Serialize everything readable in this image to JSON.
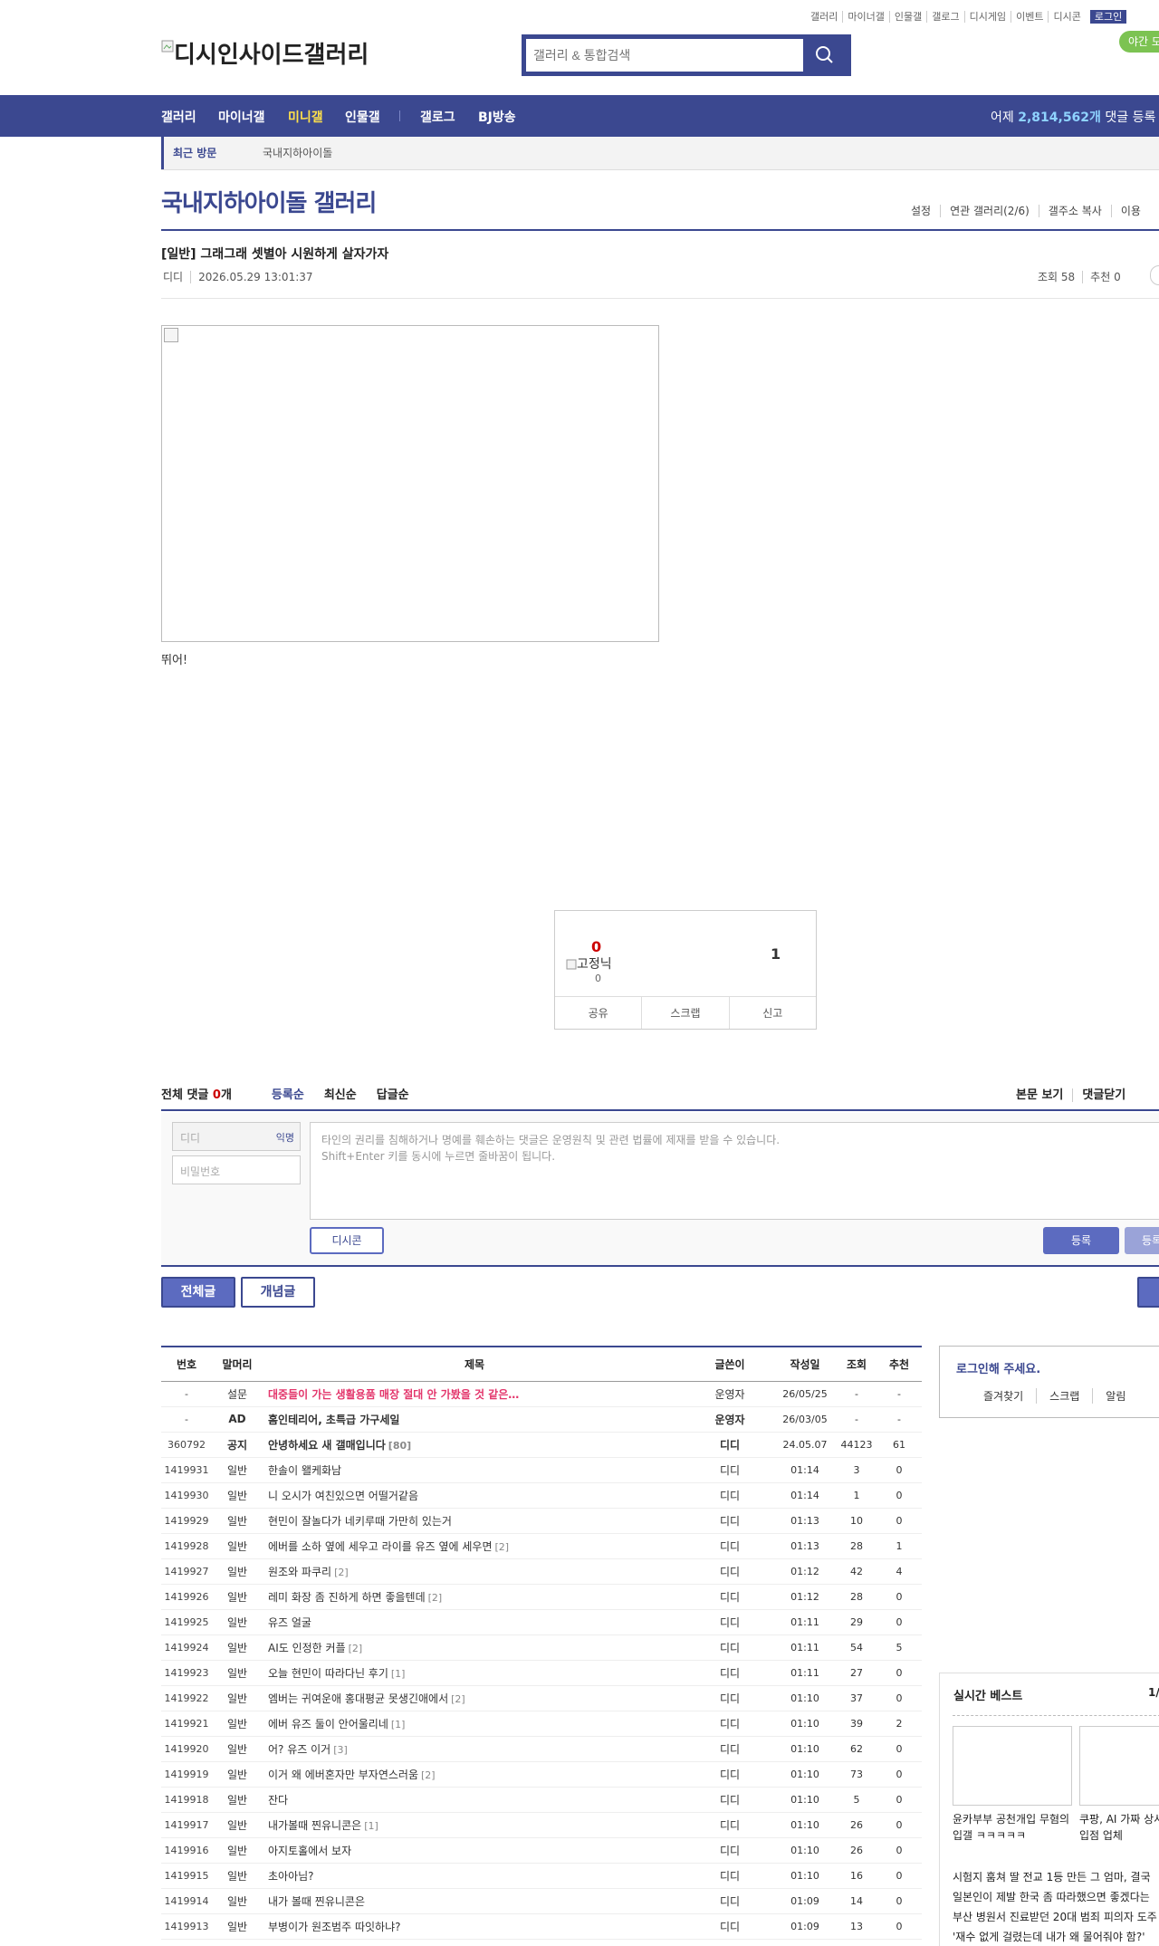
{
  "top_nav": [
    "갤러리",
    "마이너갤",
    "인물갤",
    "갤로그",
    "디시게임",
    "이벤트",
    "디시콘"
  ],
  "login_label": "로그인",
  "logo_text": "디시인사이드갤러리",
  "search": {
    "placeholder": "갤러리 & 통합검색"
  },
  "night_mode": "야간 모드",
  "gnb": {
    "items": [
      "갤러리",
      "마이너갤",
      "미니갤",
      "인물갤",
      "갤로그",
      "BJ방송"
    ],
    "active": "미니갤",
    "stat_prefix": "어제 ",
    "stat_value": "2,814,562개",
    "stat_suffix": " 댓글 등록"
  },
  "subbar": {
    "recent_label": "최근 방문",
    "recent_item": "국내지하아이돌"
  },
  "gallery": {
    "title": "국내지하아이돌 갤러리",
    "utils": [
      "설정",
      "연관 갤러리(2/6)",
      "갤주소 복사",
      "이용"
    ]
  },
  "post": {
    "title": "[일반] 그래그래 셋별아 시원하게 살자가자",
    "writer": "디디",
    "datetime": "2026.05.29 13:01:37",
    "views": "조회 58",
    "recommends": "추천 0",
    "body": "뛰어!"
  },
  "recommend_box": {
    "up_count": "0",
    "fixed_label": "고정닉",
    "fixed_count": "0",
    "down_count": "1",
    "actions": [
      "공유",
      "스크랩",
      "신고"
    ]
  },
  "comments": {
    "total_label": "전체 댓글",
    "total_count": "0",
    "total_unit": "개",
    "sorts": [
      "등록순",
      "최신순",
      "답글순"
    ],
    "right_links": [
      "본문 보기",
      "댓글닫기"
    ],
    "name_placeholder": "디디",
    "anon_label": "익명",
    "password_placeholder": "비밀번호",
    "text_line1": "타인의 권리를 침해하거나 명예를 훼손하는 댓글은 운영원칙 및 관련 법률에 제재를 받을 수 있습니다.",
    "text_line2": "Shift+Enter 키를 동시에 누르면 줄바꿈이 됩니다.",
    "dccon_label": "디시콘",
    "submit_label": "등록",
    "submit2_label": "등록"
  },
  "list_tabs": {
    "all": "전체글",
    "concept": "개념글"
  },
  "table": {
    "headers": [
      "번호",
      "말머리",
      "제목",
      "글쓴이",
      "작성일",
      "조회",
      "추천"
    ],
    "rows": [
      {
        "num": "-",
        "head": "설문",
        "title": "대중들이 가는 생활용품 매장 절대 안 가봤을 것 같은…",
        "rc": "",
        "writer": "운영자",
        "date": "26/05/25",
        "views": "-",
        "rec": "-",
        "type": "survey"
      },
      {
        "num": "-",
        "head": "AD",
        "title": "홈인테리어, 초특급 가구세일",
        "rc": "",
        "writer": "운영자",
        "date": "26/03/05",
        "views": "-",
        "rec": "-",
        "type": "notice"
      },
      {
        "num": "360792",
        "head": "공지",
        "title": "안녕하세요 새 갤매입니다",
        "rc": "[80]",
        "writer": "디디",
        "date": "24.05.07",
        "views": "44123",
        "rec": "61",
        "type": "notice"
      },
      {
        "num": "1419931",
        "head": "일반",
        "title": "한솔이 왤케화남",
        "rc": "",
        "writer": "디디",
        "date": "01:14",
        "views": "3",
        "rec": "0",
        "type": ""
      },
      {
        "num": "1419930",
        "head": "일반",
        "title": "니 오시가 여친있으면 어떨거같음",
        "rc": "",
        "writer": "디디",
        "date": "01:14",
        "views": "1",
        "rec": "0",
        "type": ""
      },
      {
        "num": "1419929",
        "head": "일반",
        "title": "현민이 잘놀다가 네키루때 가만히 있는거",
        "rc": "",
        "writer": "디디",
        "date": "01:13",
        "views": "10",
        "rec": "0",
        "type": ""
      },
      {
        "num": "1419928",
        "head": "일반",
        "title": "에버를 소하 옆에 세우고 라이를 유즈 옆에 세우면",
        "rc": "[2]",
        "writer": "디디",
        "date": "01:13",
        "views": "28",
        "rec": "1",
        "type": ""
      },
      {
        "num": "1419927",
        "head": "일반",
        "title": "원조와 파쿠리",
        "rc": "[2]",
        "writer": "디디",
        "date": "01:12",
        "views": "42",
        "rec": "4",
        "type": ""
      },
      {
        "num": "1419926",
        "head": "일반",
        "title": "레미 화장 좀 진하게 하면 좋을텐데",
        "rc": "[2]",
        "writer": "디디",
        "date": "01:12",
        "views": "28",
        "rec": "0",
        "type": ""
      },
      {
        "num": "1419925",
        "head": "일반",
        "title": "유즈 얼굴",
        "rc": "",
        "writer": "디디",
        "date": "01:11",
        "views": "29",
        "rec": "0",
        "type": ""
      },
      {
        "num": "1419924",
        "head": "일반",
        "title": "AI도 인정한 커플",
        "rc": "[2]",
        "writer": "디디",
        "date": "01:11",
        "views": "54",
        "rec": "5",
        "type": ""
      },
      {
        "num": "1419923",
        "head": "일반",
        "title": "오늘 현민이 따라다닌 후기",
        "rc": "[1]",
        "writer": "디디",
        "date": "01:11",
        "views": "27",
        "rec": "0",
        "type": ""
      },
      {
        "num": "1419922",
        "head": "일반",
        "title": "엠버는 귀여운애 홍대평균 못생긴애에서",
        "rc": "[2]",
        "writer": "디디",
        "date": "01:10",
        "views": "37",
        "rec": "0",
        "type": ""
      },
      {
        "num": "1419921",
        "head": "일반",
        "title": "에버 유즈 둘이 안어울리네",
        "rc": "[1]",
        "writer": "디디",
        "date": "01:10",
        "views": "39",
        "rec": "2",
        "type": ""
      },
      {
        "num": "1419920",
        "head": "일반",
        "title": "어? 유즈 이거",
        "rc": "[3]",
        "writer": "디디",
        "date": "01:10",
        "views": "62",
        "rec": "0",
        "type": ""
      },
      {
        "num": "1419919",
        "head": "일반",
        "title": "이거 왜 에버혼자만 부자연스러움",
        "rc": "[2]",
        "writer": "디디",
        "date": "01:10",
        "views": "73",
        "rec": "0",
        "type": ""
      },
      {
        "num": "1419918",
        "head": "일반",
        "title": "잔다",
        "rc": "",
        "writer": "디디",
        "date": "01:10",
        "views": "5",
        "rec": "0",
        "type": ""
      },
      {
        "num": "1419917",
        "head": "일반",
        "title": "내가볼때 찐유니콘은",
        "rc": "[1]",
        "writer": "디디",
        "date": "01:10",
        "views": "26",
        "rec": "0",
        "type": ""
      },
      {
        "num": "1419916",
        "head": "일반",
        "title": "아지토홀에서 보자",
        "rc": "",
        "writer": "디디",
        "date": "01:10",
        "views": "26",
        "rec": "0",
        "type": ""
      },
      {
        "num": "1419915",
        "head": "일반",
        "title": "초아아님?",
        "rc": "",
        "writer": "디디",
        "date": "01:10",
        "views": "16",
        "rec": "0",
        "type": ""
      },
      {
        "num": "1419914",
        "head": "일반",
        "title": "내가 볼때 찐유니콘은",
        "rc": "",
        "writer": "디디",
        "date": "01:09",
        "views": "14",
        "rec": "0",
        "type": ""
      },
      {
        "num": "1419913",
        "head": "일반",
        "title": "부병이가 원조범주 따잇하냐?",
        "rc": "",
        "writer": "디디",
        "date": "01:09",
        "views": "13",
        "rec": "0",
        "type": ""
      }
    ]
  },
  "login_box": {
    "title": "로그인해 주세요.",
    "links": [
      "즐겨찾기",
      "스크랩",
      "알림"
    ]
  },
  "best": {
    "title": "실시간 베스트",
    "page": "1/",
    "cards": [
      "윤카부부 공천개입 무혐의입갤 ㅋㅋㅋㅋㅋ",
      "쿠팡, AI 가짜 상사지로 미입점 업체"
    ],
    "lines": [
      "시험지 훔쳐 딸 전교 1등 만든 그 엄마, 결국",
      "일본인이 제발 한국 좀 따라했으면 좋겠다는",
      "부산 병원서 진료받던 20대 범죄 피의자 도주",
      "'재수 없게 걸렸는데 내가 왜 물어줘야 함?'"
    ]
  },
  "colors": {
    "brand": "#3b4890",
    "accent_red": "#cc0000",
    "survey": "#e3356b",
    "night_btn": "#7cc352"
  }
}
